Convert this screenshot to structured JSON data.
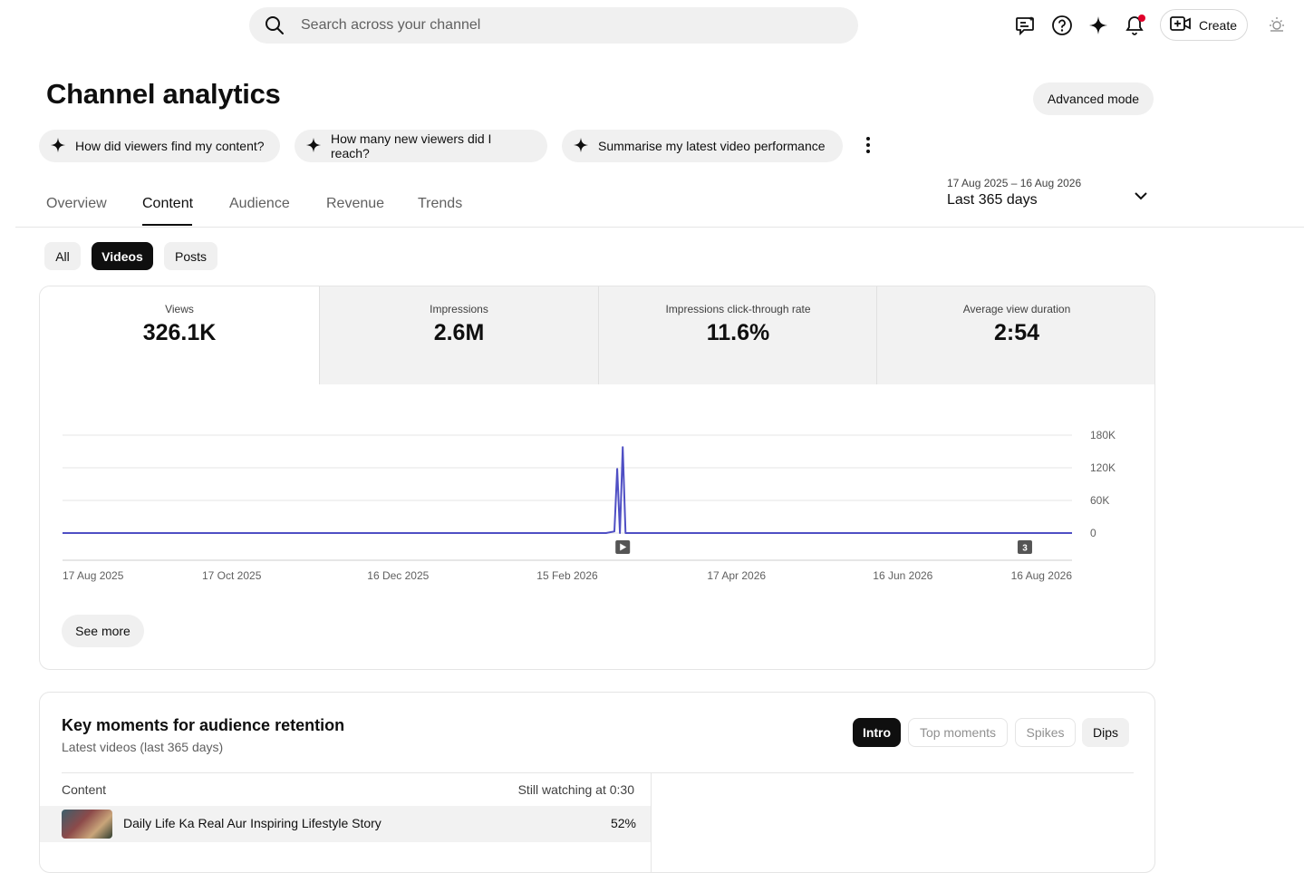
{
  "search": {
    "placeholder": "Search across your channel"
  },
  "topbar": {
    "icons": [
      "feedback-icon",
      "help-icon",
      "sparkle-icon",
      "notification-icon",
      "theme-icon"
    ],
    "create_label": "Create",
    "notification_dot_color": "#e0002a"
  },
  "page": {
    "title": "Channel analytics",
    "advanced_mode": "Advanced mode"
  },
  "suggestions": [
    "How did viewers find my content?",
    "How many new viewers did I reach?",
    "Summarise my latest video performance"
  ],
  "tabs": [
    {
      "label": "Overview",
      "active": false
    },
    {
      "label": "Content",
      "active": true
    },
    {
      "label": "Audience",
      "active": false
    },
    {
      "label": "Revenue",
      "active": false
    },
    {
      "label": "Trends",
      "active": false
    }
  ],
  "date_range": {
    "range": "17 Aug 2025 – 16 Aug 2026",
    "label": "Last 365 days"
  },
  "filters": [
    {
      "label": "All",
      "active": false
    },
    {
      "label": "Videos",
      "active": true
    },
    {
      "label": "Posts",
      "active": false
    }
  ],
  "metrics": [
    {
      "label": "Views",
      "value": "326.1K",
      "active": true
    },
    {
      "label": "Impressions",
      "value": "2.6M",
      "active": false
    },
    {
      "label": "Impressions click-through rate",
      "value": "11.6%",
      "active": false
    },
    {
      "label": "Average view duration",
      "value": "2:54",
      "active": false
    }
  ],
  "chart_data": {
    "type": "line",
    "series": [
      {
        "x": [
          "2025-08-17",
          "2026-03-01",
          "2026-03-04",
          "2026-03-05",
          "2026-03-06",
          "2026-03-07",
          "2026-03-08",
          "2026-08-16"
        ],
        "values": [
          0,
          0,
          3000,
          118000,
          0,
          158000,
          0,
          0
        ],
        "color": "#4f4fc4"
      }
    ],
    "x_tick_labels": [
      "17 Aug 2025",
      "17 Oct 2025",
      "16 Dec 2025",
      "15 Feb 2026",
      "17 Apr 2026",
      "16 Jun 2026",
      "16 Aug 2026"
    ],
    "x_tick_dates": [
      "2025-08-17",
      "2025-10-17",
      "2025-12-16",
      "2026-02-15",
      "2026-04-17",
      "2026-06-16",
      "2026-08-16"
    ],
    "y_ticks": [
      0,
      60000,
      120000,
      180000
    ],
    "y_tick_labels": [
      "0",
      "60K",
      "120K",
      "180K"
    ],
    "ylim": [
      0,
      180000
    ],
    "grid": true,
    "markers": [
      {
        "date": "2026-03-07",
        "kind": "video-icon",
        "label": ""
      },
      {
        "date": "2026-07-30",
        "kind": "count-badge",
        "label": "3"
      }
    ]
  },
  "see_more": "See more",
  "key_moments": {
    "title": "Key moments for audience retention",
    "subtitle": "Latest videos (last 365 days)",
    "segments": [
      "Intro",
      "Top moments",
      "Spikes",
      "Dips"
    ],
    "col_content": "Content",
    "col_still_watching": "Still watching at 0:30",
    "rows": [
      {
        "title": "Daily Life Ka Real Aur Inspiring Lifestyle Story",
        "value": "52%"
      }
    ]
  }
}
